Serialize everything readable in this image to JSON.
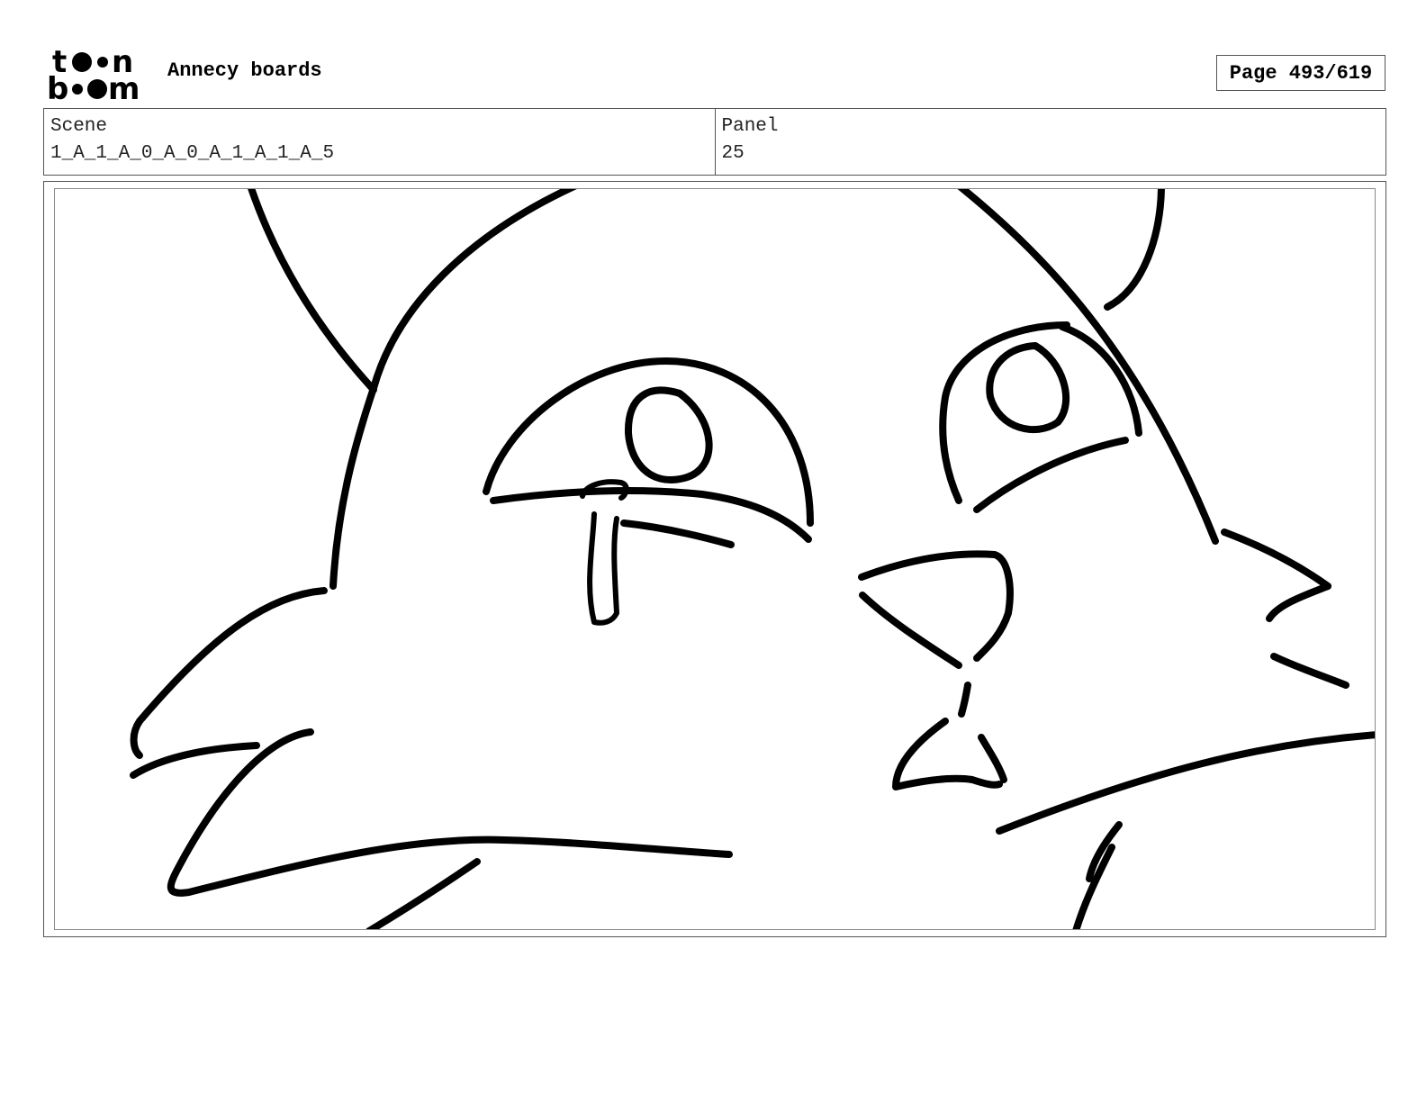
{
  "header": {
    "logo_text": "toonboom",
    "title": "Annecy boards",
    "page_label": "Page 493/619"
  },
  "info": {
    "scene_label": "Scene",
    "scene_value": "1_A_1_A_0_A_0_A_1_A_1_A_5",
    "panel_label": "Panel",
    "panel_value": "25"
  }
}
